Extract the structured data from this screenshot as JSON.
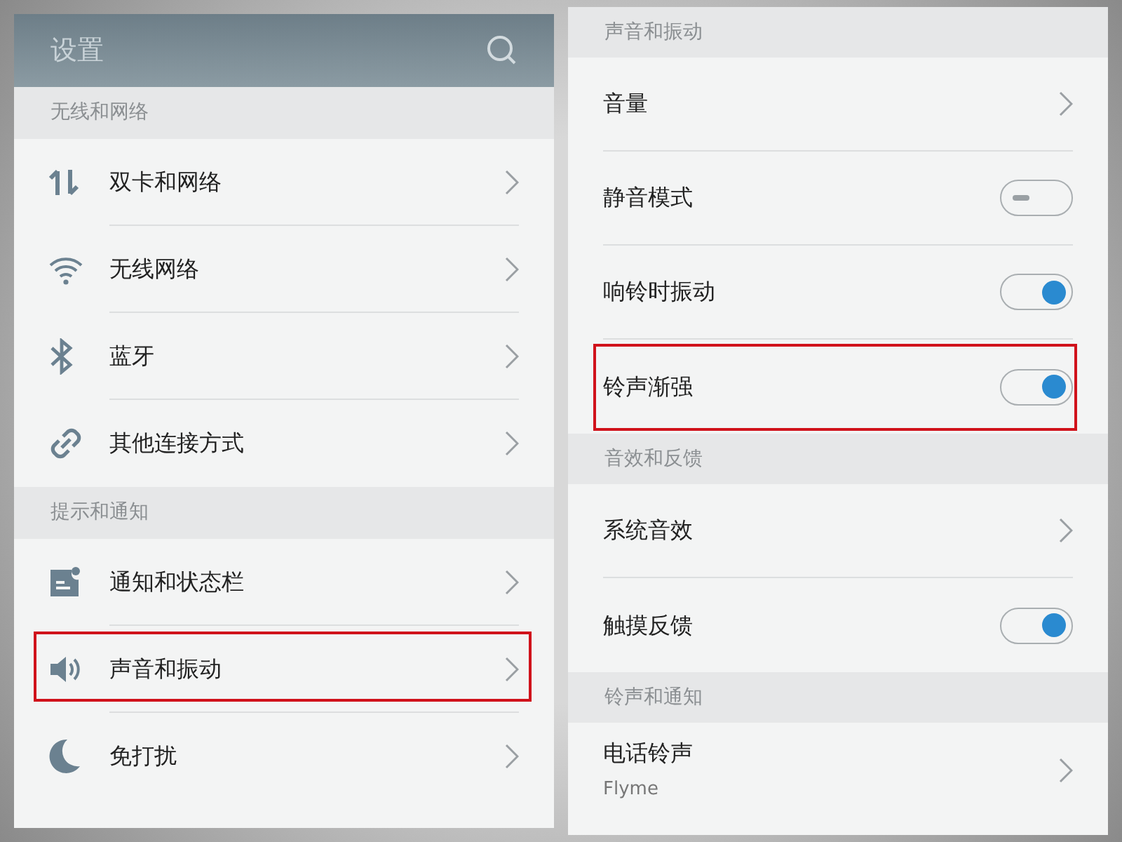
{
  "left_screen": {
    "title": "设置",
    "sections": [
      {
        "header": "无线和网络",
        "items": [
          {
            "label": "双卡和网络",
            "highlighted": false
          },
          {
            "label": "无线网络",
            "highlighted": false
          },
          {
            "label": "蓝牙",
            "highlighted": false
          },
          {
            "label": "其他连接方式",
            "highlighted": false
          }
        ]
      },
      {
        "header": "提示和通知",
        "items": [
          {
            "label": "通知和状态栏",
            "highlighted": false
          },
          {
            "label": "声音和振动",
            "highlighted": true
          },
          {
            "label": "免打扰",
            "highlighted": false
          }
        ]
      }
    ]
  },
  "right_screen": {
    "sections": [
      {
        "header": "声音和振动",
        "items": [
          {
            "kind": "link",
            "label": "音量",
            "highlighted": false
          },
          {
            "kind": "toggle",
            "label": "静音模式",
            "on": false,
            "highlighted": false
          },
          {
            "kind": "toggle",
            "label": "响铃时振动",
            "on": true,
            "highlighted": false
          },
          {
            "kind": "toggle",
            "label": "铃声渐强",
            "on": true,
            "highlighted": true
          }
        ]
      },
      {
        "header": "音效和反馈",
        "items": [
          {
            "kind": "link",
            "label": "系统音效",
            "highlighted": false
          },
          {
            "kind": "toggle",
            "label": "触摸反馈",
            "on": true,
            "highlighted": false
          }
        ]
      },
      {
        "header": "铃声和通知",
        "items": [
          {
            "kind": "link",
            "label": "电话铃声",
            "subtitle": "Flyme",
            "highlighted": false
          }
        ]
      }
    ]
  }
}
